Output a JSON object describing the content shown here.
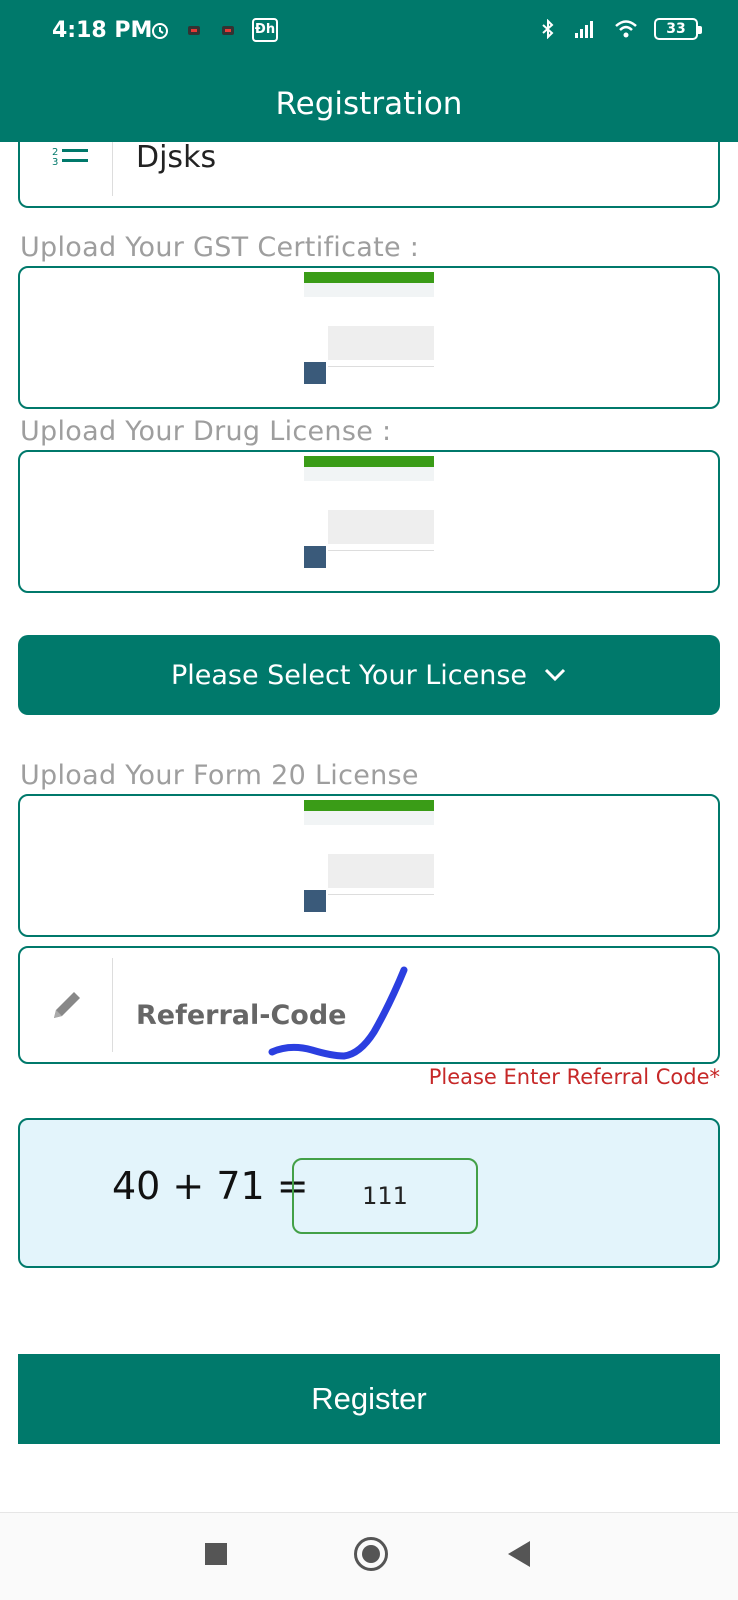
{
  "status_bar": {
    "time": "4:18 PM",
    "app_badge": "Ɖh",
    "battery": "33"
  },
  "app_bar": {
    "title": "Registration"
  },
  "name_field": {
    "value": "Djsks"
  },
  "gst": {
    "label": "Upload Your GST Certificate :"
  },
  "drug": {
    "label": "Upload Your Drug License :"
  },
  "license_select": {
    "label": "Please Select Your License"
  },
  "form20": {
    "label": "Upload Your Form 20 License"
  },
  "referral": {
    "placeholder": "Referral-Code",
    "error": "Please Enter Referral Code*"
  },
  "captcha": {
    "equation": "40 + 71 =",
    "answer": "111"
  },
  "register": {
    "label": "Register"
  },
  "colors": {
    "primary": "#00796b",
    "error": "#c62828",
    "captcha_bg": "#e3f4fb",
    "stroke": "#2b3fe0"
  }
}
